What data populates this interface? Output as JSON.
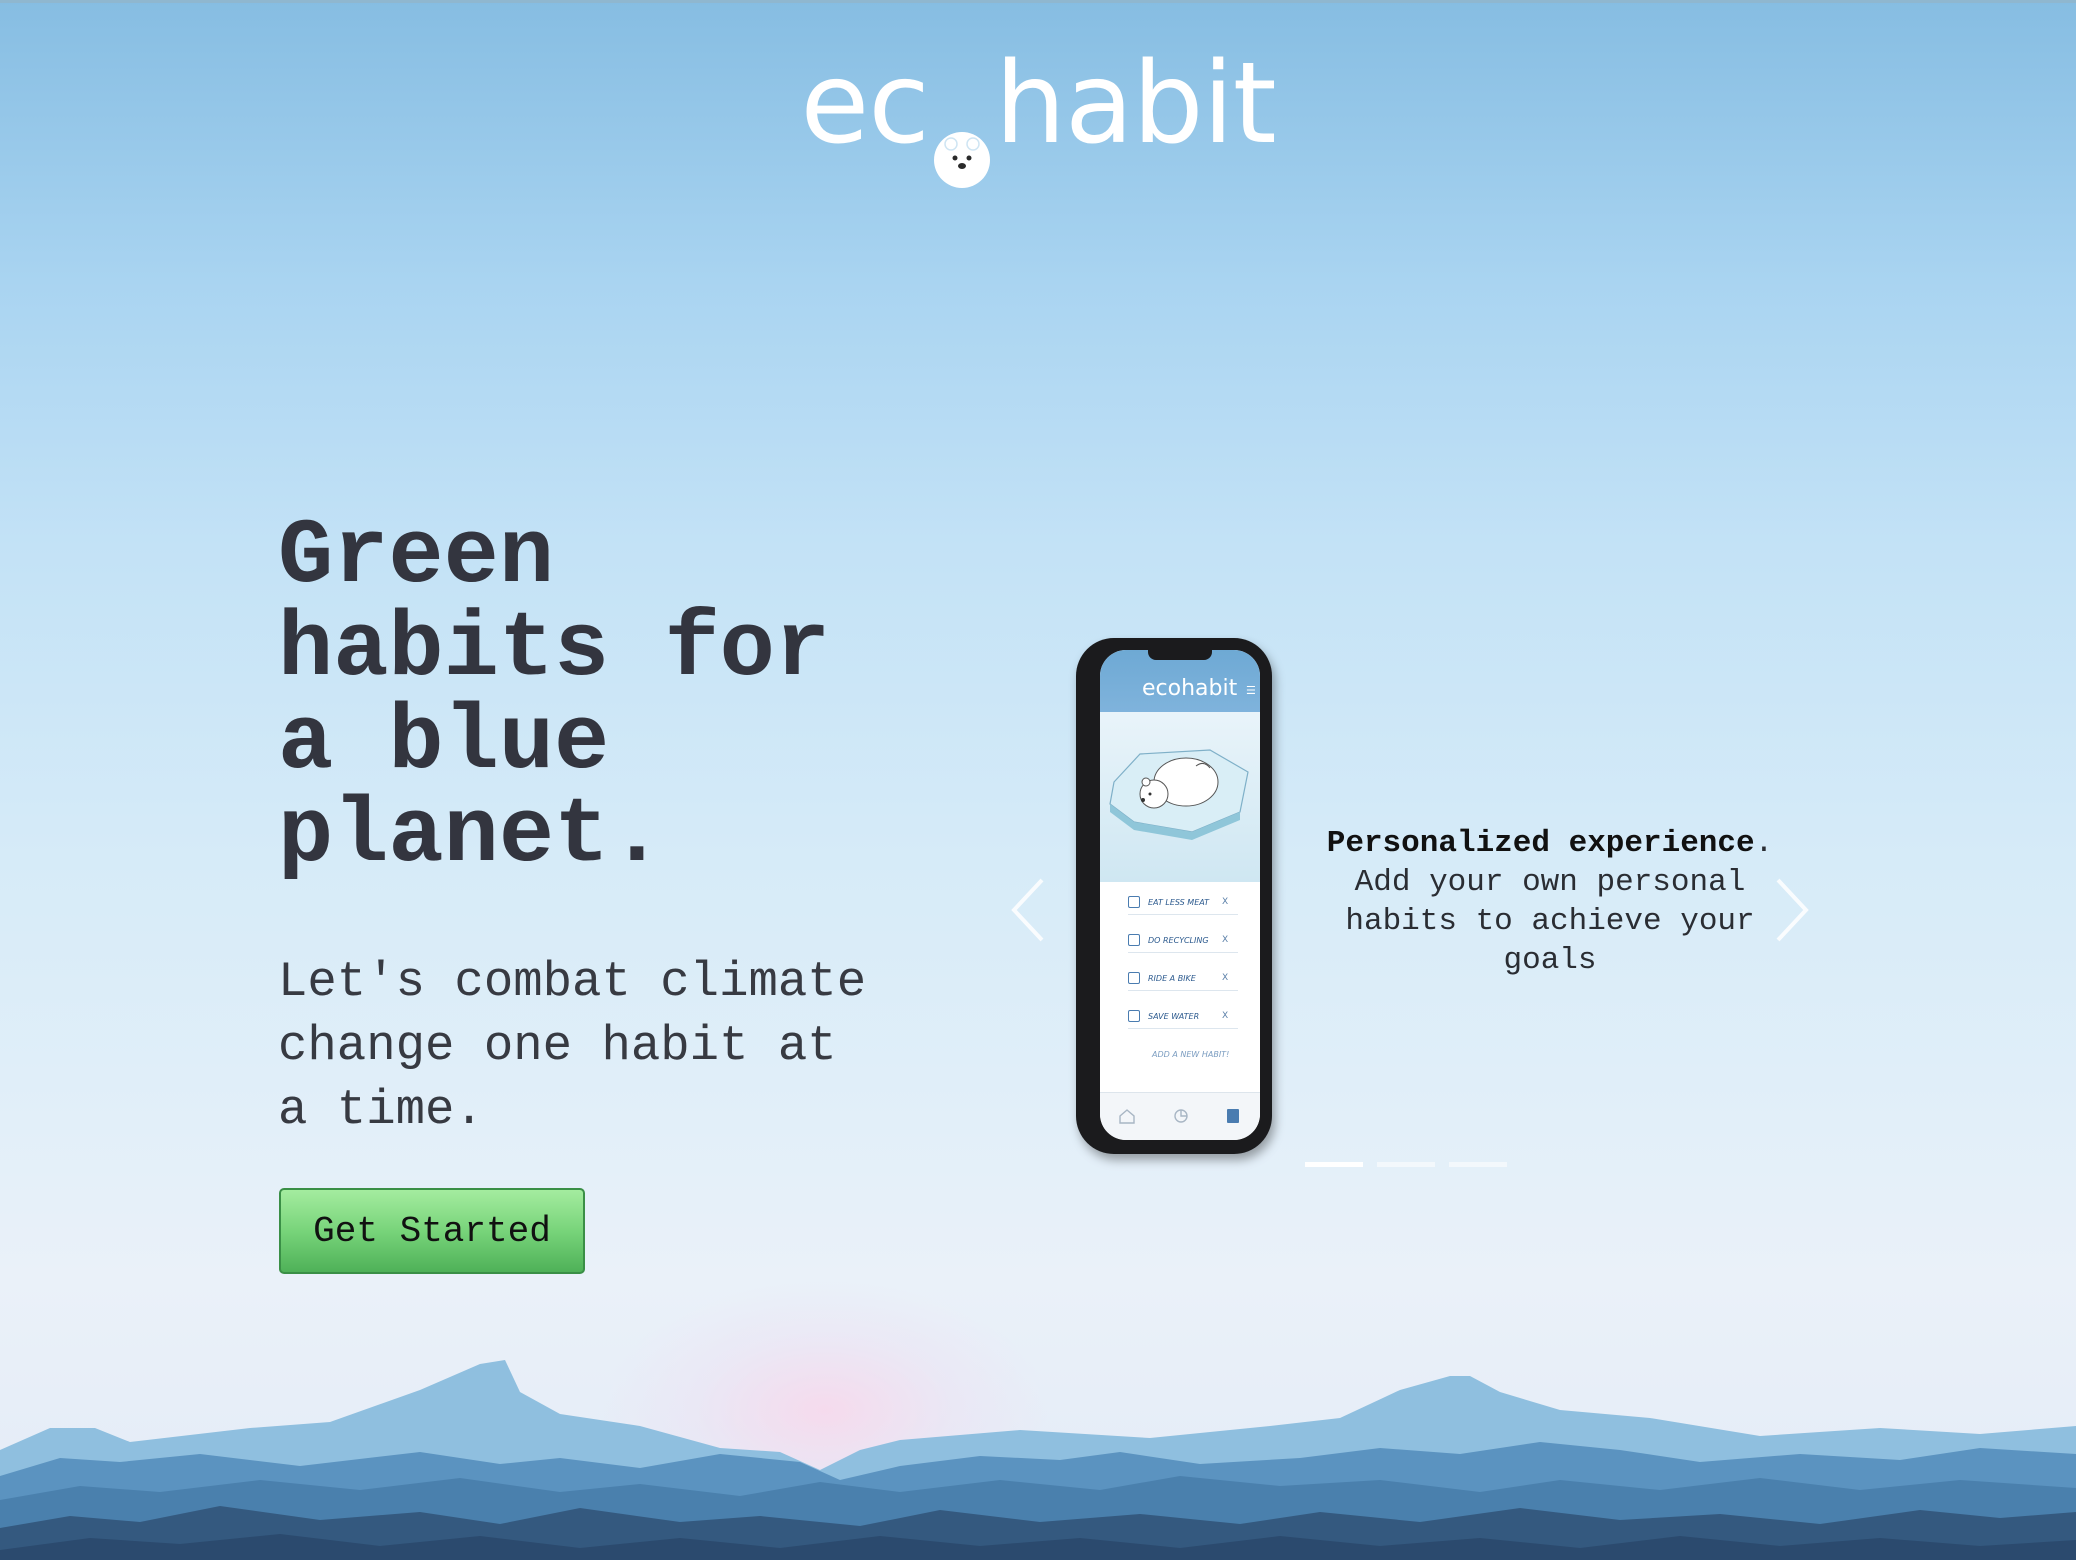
{
  "header": {
    "logo_text_left": "ec",
    "logo_text_right": "habit",
    "logo_icon": "polar-bear-icon"
  },
  "hero": {
    "title": "Green\nhabits for\na blue\nplanet.",
    "subtitle": "Let's combat climate\nchange one habit at\na time.",
    "cta_label": "Get Started"
  },
  "carousel": {
    "slide_caption_bold": "Personalized experience",
    "slide_caption_bold_suffix": ".",
    "slide_caption_text": "Add your own personal habits to achieve your goals",
    "prev_icon": "chevron-left-icon",
    "next_icon": "chevron-right-icon",
    "indicator_count": 3,
    "active_index": 0,
    "phone": {
      "app_title": "ecohabit",
      "menu_icon": "menu-icon",
      "habits": [
        {
          "label": "EAT LESS MEAT",
          "icon": "meat-icon"
        },
        {
          "label": "DO RECYCLING",
          "icon": "recycle-icon"
        },
        {
          "label": "RIDE A BIKE",
          "icon": "bike-icon"
        },
        {
          "label": "SAVE WATER",
          "icon": "water-drop-icon"
        }
      ],
      "habit_delete_label": "X",
      "add_habit_label": "ADD A NEW HABIT!",
      "tabs": [
        "home-icon",
        "stats-icon",
        "habits-icon"
      ]
    }
  },
  "colors": {
    "title_text": "#33353f",
    "button_green": "#78d47a",
    "sky_top": "#86bde2",
    "sky_bottom": "#eaf1f9",
    "mountain_dark": "#2c4a6f",
    "mountain_light": "#7fb3d8"
  }
}
